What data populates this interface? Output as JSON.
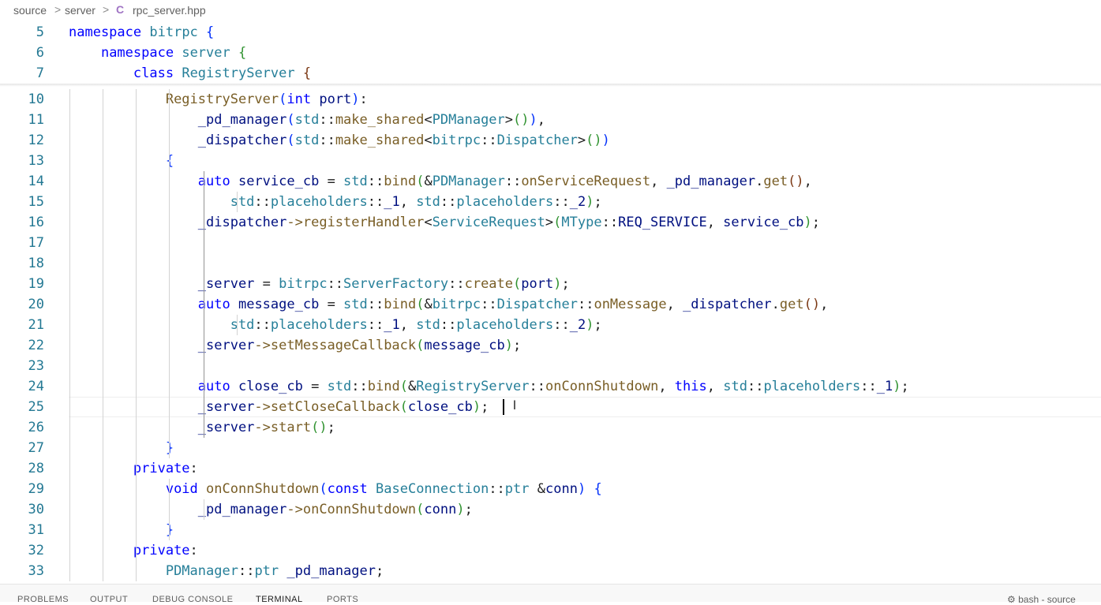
{
  "breadcrumb": {
    "items": [
      "source",
      "server",
      "rpc_server.hpp"
    ],
    "separator": ">",
    "file_icon": "cpp-file-icon",
    "file_icon_color": "#a074c4"
  },
  "sticky_lines": [
    {
      "n": "5",
      "tokens": [
        [
          "kw",
          "namespace"
        ],
        [
          "op",
          " "
        ],
        [
          "ns",
          "bitrpc"
        ],
        [
          "op",
          " "
        ],
        [
          "b1",
          "{"
        ]
      ]
    },
    {
      "n": "6",
      "tokens": [
        [
          "op",
          "    "
        ],
        [
          "kw",
          "namespace"
        ],
        [
          "op",
          " "
        ],
        [
          "ns",
          "server"
        ],
        [
          "op",
          " "
        ],
        [
          "b2",
          "{"
        ]
      ]
    },
    {
      "n": "7",
      "tokens": [
        [
          "op",
          "        "
        ],
        [
          "kw",
          "class"
        ],
        [
          "op",
          " "
        ],
        [
          "ty",
          "RegistryServer"
        ],
        [
          "op",
          " "
        ],
        [
          "b3",
          "{"
        ]
      ]
    }
  ],
  "lines": [
    {
      "n": "10",
      "tokens": [
        [
          "op",
          "            "
        ],
        [
          "fn",
          "RegistryServer"
        ],
        [
          "b1",
          "("
        ],
        [
          "kw",
          "int"
        ],
        [
          "op",
          " "
        ],
        [
          "vr",
          "port"
        ],
        [
          "b1",
          ")"
        ],
        [
          "op",
          ":"
        ]
      ]
    },
    {
      "n": "11",
      "tokens": [
        [
          "op",
          "                "
        ],
        [
          "vr",
          "_pd_manager"
        ],
        [
          "b1",
          "("
        ],
        [
          "ns",
          "std"
        ],
        [
          "op",
          "::"
        ],
        [
          "fn",
          "make_shared"
        ],
        [
          "op",
          "<"
        ],
        [
          "ty",
          "PDManager"
        ],
        [
          "op",
          ">"
        ],
        [
          "b2",
          "()"
        ],
        [
          "b1",
          ")"
        ],
        [
          "op",
          ","
        ]
      ]
    },
    {
      "n": "12",
      "tokens": [
        [
          "op",
          "                "
        ],
        [
          "vr",
          "_dispatcher"
        ],
        [
          "b1",
          "("
        ],
        [
          "ns",
          "std"
        ],
        [
          "op",
          "::"
        ],
        [
          "fn",
          "make_shared"
        ],
        [
          "op",
          "<"
        ],
        [
          "ns",
          "bitrpc"
        ],
        [
          "op",
          "::"
        ],
        [
          "ty",
          "Dispatcher"
        ],
        [
          "op",
          ">"
        ],
        [
          "b2",
          "()"
        ],
        [
          "b1",
          ")"
        ]
      ]
    },
    {
      "n": "13",
      "tokens": [
        [
          "op",
          "            "
        ],
        [
          "b1",
          "{"
        ]
      ]
    },
    {
      "n": "14",
      "tokens": [
        [
          "op",
          "                "
        ],
        [
          "kw",
          "auto"
        ],
        [
          "op",
          " "
        ],
        [
          "vr",
          "service_cb"
        ],
        [
          "op",
          " = "
        ],
        [
          "ns",
          "std"
        ],
        [
          "op",
          "::"
        ],
        [
          "fn",
          "bind"
        ],
        [
          "b2",
          "("
        ],
        [
          "op",
          "&"
        ],
        [
          "ty",
          "PDManager"
        ],
        [
          "op",
          "::"
        ],
        [
          "fn",
          "onServiceRequest"
        ],
        [
          "op",
          ", "
        ],
        [
          "vr",
          "_pd_manager"
        ],
        [
          "op",
          "."
        ],
        [
          "fn",
          "get"
        ],
        [
          "b3",
          "()"
        ],
        [
          "op",
          ","
        ]
      ]
    },
    {
      "n": "15",
      "tokens": [
        [
          "op",
          "                    "
        ],
        [
          "ns",
          "std"
        ],
        [
          "op",
          "::"
        ],
        [
          "ns",
          "placeholders"
        ],
        [
          "op",
          "::"
        ],
        [
          "vr",
          "_1"
        ],
        [
          "op",
          ", "
        ],
        [
          "ns",
          "std"
        ],
        [
          "op",
          "::"
        ],
        [
          "ns",
          "placeholders"
        ],
        [
          "op",
          "::"
        ],
        [
          "vr",
          "_2"
        ],
        [
          "b2",
          ")"
        ],
        [
          "op",
          ";"
        ]
      ]
    },
    {
      "n": "16",
      "tokens": [
        [
          "op",
          "                "
        ],
        [
          "vr",
          "_dispatcher"
        ],
        [
          "ar",
          "->"
        ],
        [
          "fn",
          "registerHandler"
        ],
        [
          "op",
          "<"
        ],
        [
          "ty",
          "ServiceRequest"
        ],
        [
          "op",
          ">"
        ],
        [
          "b2",
          "("
        ],
        [
          "ty",
          "MType"
        ],
        [
          "op",
          "::"
        ],
        [
          "vr",
          "REQ_SERVICE"
        ],
        [
          "op",
          ", "
        ],
        [
          "vr",
          "service_cb"
        ],
        [
          "b2",
          ")"
        ],
        [
          "op",
          ";"
        ]
      ]
    },
    {
      "n": "17",
      "tokens": []
    },
    {
      "n": "18",
      "tokens": []
    },
    {
      "n": "19",
      "tokens": [
        [
          "op",
          "                "
        ],
        [
          "vr",
          "_server"
        ],
        [
          "op",
          " = "
        ],
        [
          "ns",
          "bitrpc"
        ],
        [
          "op",
          "::"
        ],
        [
          "ty",
          "ServerFactory"
        ],
        [
          "op",
          "::"
        ],
        [
          "fn",
          "create"
        ],
        [
          "b2",
          "("
        ],
        [
          "vr",
          "port"
        ],
        [
          "b2",
          ")"
        ],
        [
          "op",
          ";"
        ]
      ]
    },
    {
      "n": "20",
      "tokens": [
        [
          "op",
          "                "
        ],
        [
          "kw",
          "auto"
        ],
        [
          "op",
          " "
        ],
        [
          "vr",
          "message_cb"
        ],
        [
          "op",
          " = "
        ],
        [
          "ns",
          "std"
        ],
        [
          "op",
          "::"
        ],
        [
          "fn",
          "bind"
        ],
        [
          "b2",
          "("
        ],
        [
          "op",
          "&"
        ],
        [
          "ns",
          "bitrpc"
        ],
        [
          "op",
          "::"
        ],
        [
          "ty",
          "Dispatcher"
        ],
        [
          "op",
          "::"
        ],
        [
          "fn",
          "onMessage"
        ],
        [
          "op",
          ", "
        ],
        [
          "vr",
          "_dispatcher"
        ],
        [
          "op",
          "."
        ],
        [
          "fn",
          "get"
        ],
        [
          "b3",
          "()"
        ],
        [
          "op",
          ","
        ]
      ]
    },
    {
      "n": "21",
      "tokens": [
        [
          "op",
          "                    "
        ],
        [
          "ns",
          "std"
        ],
        [
          "op",
          "::"
        ],
        [
          "ns",
          "placeholders"
        ],
        [
          "op",
          "::"
        ],
        [
          "vr",
          "_1"
        ],
        [
          "op",
          ", "
        ],
        [
          "ns",
          "std"
        ],
        [
          "op",
          "::"
        ],
        [
          "ns",
          "placeholders"
        ],
        [
          "op",
          "::"
        ],
        [
          "vr",
          "_2"
        ],
        [
          "b2",
          ")"
        ],
        [
          "op",
          ";"
        ]
      ]
    },
    {
      "n": "22",
      "tokens": [
        [
          "op",
          "                "
        ],
        [
          "vr",
          "_server"
        ],
        [
          "ar",
          "->"
        ],
        [
          "fn",
          "setMessageCallback"
        ],
        [
          "b2",
          "("
        ],
        [
          "vr",
          "message_cb"
        ],
        [
          "b2",
          ")"
        ],
        [
          "op",
          ";"
        ]
      ]
    },
    {
      "n": "23",
      "tokens": []
    },
    {
      "n": "24",
      "tokens": [
        [
          "op",
          "                "
        ],
        [
          "kw",
          "auto"
        ],
        [
          "op",
          " "
        ],
        [
          "vr",
          "close_cb"
        ],
        [
          "op",
          " = "
        ],
        [
          "ns",
          "std"
        ],
        [
          "op",
          "::"
        ],
        [
          "fn",
          "bind"
        ],
        [
          "b2",
          "("
        ],
        [
          "op",
          "&"
        ],
        [
          "ty",
          "RegistryServer"
        ],
        [
          "op",
          "::"
        ],
        [
          "fn",
          "onConnShutdown"
        ],
        [
          "op",
          ", "
        ],
        [
          "kw",
          "this"
        ],
        [
          "op",
          ", "
        ],
        [
          "ns",
          "std"
        ],
        [
          "op",
          "::"
        ],
        [
          "ns",
          "placeholders"
        ],
        [
          "op",
          "::"
        ],
        [
          "vr",
          "_1"
        ],
        [
          "b2",
          ")"
        ],
        [
          "op",
          ";"
        ]
      ]
    },
    {
      "n": "25",
      "tokens": [
        [
          "op",
          "                "
        ],
        [
          "vr",
          "_server"
        ],
        [
          "ar",
          "->"
        ],
        [
          "fn",
          "setCloseCallback"
        ],
        [
          "b2",
          "("
        ],
        [
          "vr",
          "close_cb"
        ],
        [
          "b2",
          ")"
        ],
        [
          "op",
          ";"
        ]
      ]
    },
    {
      "n": "26",
      "tokens": [
        [
          "op",
          "                "
        ],
        [
          "vr",
          "_server"
        ],
        [
          "ar",
          "->"
        ],
        [
          "fn",
          "start"
        ],
        [
          "b2",
          "()"
        ],
        [
          "op",
          ";"
        ]
      ]
    },
    {
      "n": "27",
      "tokens": [
        [
          "op",
          "            "
        ],
        [
          "b1",
          "}"
        ]
      ]
    },
    {
      "n": "28",
      "tokens": [
        [
          "op",
          "        "
        ],
        [
          "kw",
          "private"
        ],
        [
          "op",
          ":"
        ]
      ]
    },
    {
      "n": "29",
      "tokens": [
        [
          "op",
          "            "
        ],
        [
          "kw",
          "void"
        ],
        [
          "op",
          " "
        ],
        [
          "fn",
          "onConnShutdown"
        ],
        [
          "b1",
          "("
        ],
        [
          "kw",
          "const"
        ],
        [
          "op",
          " "
        ],
        [
          "ty",
          "BaseConnection"
        ],
        [
          "op",
          "::"
        ],
        [
          "ty",
          "ptr"
        ],
        [
          "op",
          " &"
        ],
        [
          "vr",
          "conn"
        ],
        [
          "b1",
          ")"
        ],
        [
          "op",
          " "
        ],
        [
          "b1",
          "{"
        ]
      ]
    },
    {
      "n": "30",
      "tokens": [
        [
          "op",
          "                "
        ],
        [
          "vr",
          "_pd_manager"
        ],
        [
          "ar",
          "->"
        ],
        [
          "fn",
          "onConnShutdown"
        ],
        [
          "b2",
          "("
        ],
        [
          "vr",
          "conn"
        ],
        [
          "b2",
          ")"
        ],
        [
          "op",
          ";"
        ]
      ]
    },
    {
      "n": "31",
      "tokens": [
        [
          "op",
          "            "
        ],
        [
          "b1",
          "}"
        ]
      ]
    },
    {
      "n": "32",
      "tokens": [
        [
          "op",
          "        "
        ],
        [
          "kw",
          "private"
        ],
        [
          "op",
          ":"
        ]
      ]
    },
    {
      "n": "33",
      "tokens": [
        [
          "op",
          "            "
        ],
        [
          "ty",
          "PDManager"
        ],
        [
          "op",
          "::"
        ],
        [
          "ty",
          "ptr"
        ],
        [
          "op",
          " "
        ],
        [
          "vr",
          "_pd_manager"
        ],
        [
          "op",
          ";"
        ]
      ]
    }
  ],
  "cursor_line": "25",
  "panel": {
    "tabs": [
      "PROBLEMS",
      "OUTPUT",
      "DEBUG CONSOLE",
      "TERMINAL",
      "PORTS"
    ],
    "active_tab": "TERMINAL",
    "terminal_name": "bash - source"
  }
}
